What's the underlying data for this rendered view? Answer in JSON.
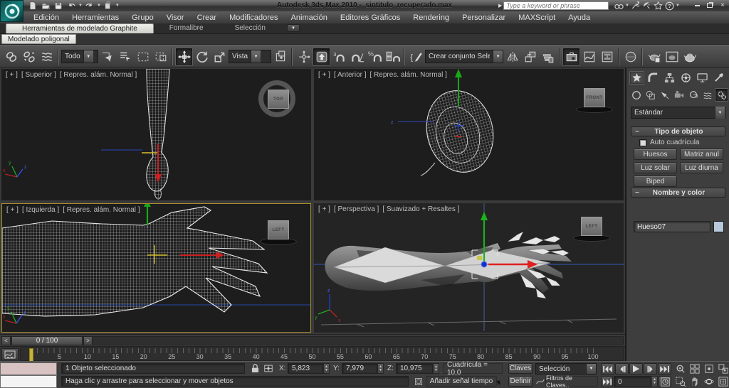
{
  "titlebar": {
    "app_title": "Autodesk 3ds Max 2010",
    "separator": "-",
    "filename": "sintitulo_recuperado.max",
    "search_placeholder": "Type a keyword or phrase"
  },
  "menus": [
    "Edición",
    "Herramientas",
    "Grupo",
    "Visor",
    "Crear",
    "Modificadores",
    "Animación",
    "Editores Gráficos",
    "Rendering",
    "Personalizar",
    "MAXScript",
    "Ayuda"
  ],
  "ribbon": {
    "tabs": [
      "Herramientas de modelado Graphite",
      "Formalibre",
      "Selección"
    ],
    "active_tab_index": 0,
    "panel_button": "Modelado poligonal"
  },
  "toolbar": {
    "selection_filter": "Todo",
    "coord_system": "Vista",
    "named_sets": "Crear conjunto Sele",
    "snap_3_label": "3"
  },
  "viewports": {
    "top_left": {
      "plus": "[ + ]",
      "name": "[ Superior ]",
      "shading": "[ Repres. alám. Normal ]",
      "viewcube": "TOP"
    },
    "top_right": {
      "plus": "[ + ]",
      "name": "[ Anterior ]",
      "shading": "[ Repres. alám. Normal ]",
      "viewcube": "FRONT"
    },
    "bottom_left": {
      "plus": "[ + ]",
      "name": "[ Izquierda ]",
      "shading": "[ Repres. alám. Normal ]",
      "viewcube": "LEFT"
    },
    "bottom_right": {
      "plus": "[ + ]",
      "name": "[ Perspectiva ]",
      "shading": "[ Suavizado + Resaltes ]",
      "viewcube": "LEFT"
    }
  },
  "command_panel": {
    "category_dropdown": "Estándar",
    "rollout_object_type": "Tipo de objeto",
    "auto_grid": "Auto cuadrícula",
    "object_buttons": [
      "Huesos",
      "Matriz anul",
      "Luz solar",
      "Luz diurna",
      "Biped"
    ],
    "rollout_name_color": "Nombre y color",
    "object_name": "Hueso07",
    "swatch_color": "#b7c9da"
  },
  "timeline": {
    "prev": "<",
    "next": ">",
    "slider_label": "0 / 100",
    "ticks": [
      0,
      5,
      10,
      15,
      20,
      25,
      30,
      35,
      40,
      45,
      50,
      55,
      60,
      65,
      70,
      75,
      80,
      85,
      90,
      95,
      100
    ]
  },
  "status": {
    "selection_status": "1 Objeto seleccionado",
    "x_label": "X:",
    "x_value": "5,823",
    "y_label": "Y:",
    "y_value": "7,979",
    "z_label": "Z:",
    "z_value": "10,975",
    "grid_label": "Cuadrícula = 10,0",
    "prompt": "Haga clic y arrastre para seleccionar y mover objetos",
    "add_time_tag": "Añadir señal tiempo",
    "keys_label": "Claves",
    "define_label": "Definir",
    "key_selection": "Selección",
    "key_filters": "Filtros de Claves..",
    "frame_value": "0"
  },
  "icons": {
    "dropdown_arrow": "▼",
    "spinner_up": "▲",
    "spinner_down": "▼",
    "search_arrow": "▶",
    "close": "×"
  },
  "colors": {
    "active_viewport_border": "#ab8d2e",
    "timeline_marker": "#c7b23a",
    "gizmo_x": "#cc2222",
    "gizmo_y": "#22aa22",
    "gizmo_z": "#2244cc"
  }
}
